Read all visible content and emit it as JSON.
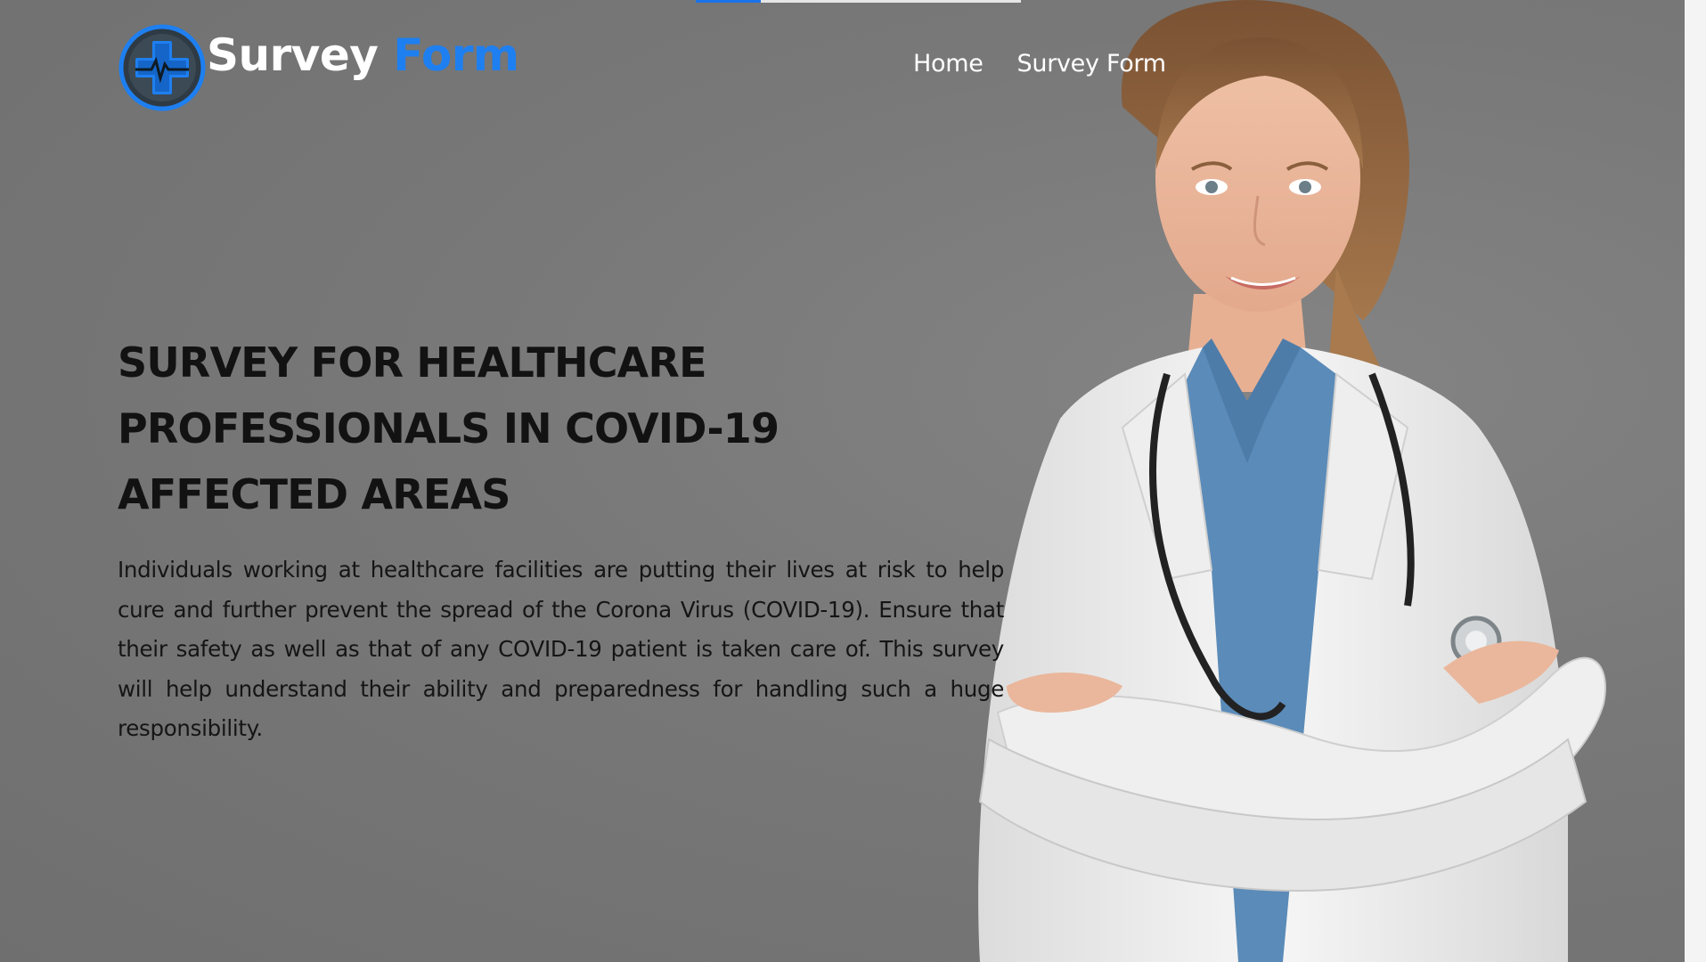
{
  "brand": {
    "part1": "Survey",
    "part2": "Form"
  },
  "nav": {
    "home": "Home",
    "survey_form": "Survey Form"
  },
  "hero": {
    "title": "SURVEY FOR HEALTHCARE PROFESSIONALS IN COVID-19 AFFECTED AREAS",
    "description": "Individuals working at healthcare facilities are putting their lives at risk to help cure and further prevent the spread of the Corona Virus (COVID-19). Ensure that their safety as well as that of any COVID-19 patient is taken care of. This survey will help understand their ability and preparedness for handling such a huge responsibility."
  },
  "colors": {
    "accent": "#1e7ff0",
    "background": "#767676",
    "heading": "#121212"
  },
  "icons": {
    "logo": "medical-cross-heartbeat-icon"
  },
  "scroll_progress": 0.2
}
